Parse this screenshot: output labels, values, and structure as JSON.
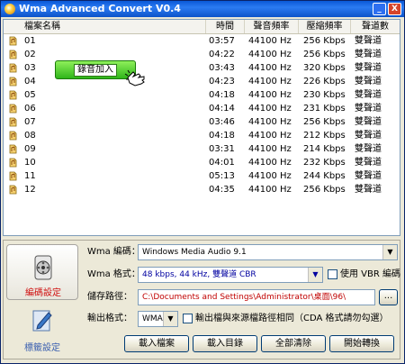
{
  "window": {
    "title": "Wma Advanced Convert V0.4",
    "min": "_",
    "close": "X"
  },
  "list": {
    "headers": {
      "name": "檔案名稱",
      "time": "時間",
      "samplerate": "聲音頻率",
      "bitrate": "壓縮頻率",
      "channels": "聲道數"
    },
    "rows": [
      {
        "name": "01",
        "time": "03:57",
        "samplerate": "44100 Hz",
        "bitrate": "256 Kbps",
        "channels": "雙聲道"
      },
      {
        "name": "02",
        "time": "04:22",
        "samplerate": "44100 Hz",
        "bitrate": "256 Kbps",
        "channels": "雙聲道"
      },
      {
        "name": "03",
        "time": "03:43",
        "samplerate": "44100 Hz",
        "bitrate": "320 Kbps",
        "channels": "雙聲道"
      },
      {
        "name": "04",
        "time": "04:23",
        "samplerate": "44100 Hz",
        "bitrate": "226 Kbps",
        "channels": "雙聲道"
      },
      {
        "name": "05",
        "time": "04:18",
        "samplerate": "44100 Hz",
        "bitrate": "230 Kbps",
        "channels": "雙聲道"
      },
      {
        "name": "06",
        "time": "04:14",
        "samplerate": "44100 Hz",
        "bitrate": "231 Kbps",
        "channels": "雙聲道"
      },
      {
        "name": "07",
        "time": "03:46",
        "samplerate": "44100 Hz",
        "bitrate": "256 Kbps",
        "channels": "雙聲道"
      },
      {
        "name": "08",
        "time": "04:18",
        "samplerate": "44100 Hz",
        "bitrate": "212 Kbps",
        "channels": "雙聲道"
      },
      {
        "name": "09",
        "time": "03:31",
        "samplerate": "44100 Hz",
        "bitrate": "214 Kbps",
        "channels": "雙聲道"
      },
      {
        "name": "10",
        "time": "04:01",
        "samplerate": "44100 Hz",
        "bitrate": "232 Kbps",
        "channels": "雙聲道"
      },
      {
        "name": "11",
        "time": "05:13",
        "samplerate": "44100 Hz",
        "bitrate": "244 Kbps",
        "channels": "雙聲道"
      },
      {
        "name": "12",
        "time": "04:35",
        "samplerate": "44100 Hz",
        "bitrate": "256 Kbps",
        "channels": "雙聲道"
      }
    ]
  },
  "drag_tooltip": "錄音加入",
  "sidebar": {
    "encode": "編碼設定",
    "tag": "標籤設定"
  },
  "form": {
    "codec_label": "Wma 編碼：",
    "codec_value": "Windows Media Audio 9.1",
    "format_label": "Wma 格式：",
    "format_value": "48 kbps, 44 kHz, 雙聲道 CBR",
    "vbr_label": "使用 VBR 編碼",
    "path_label": "儲存路徑：",
    "path_value": "C:\\Documents and Settings\\Administrator\\桌面\\96\\",
    "browse_label": "...",
    "outfmt_label": "輸出格式：",
    "outfmt_value": "WMA",
    "samepath_label": "輸出檔與來源檔路徑相同（CDA 格式請勿勾選）"
  },
  "buttons": {
    "add_file": "載入檔案",
    "add_dir": "載入目錄",
    "clear": "全部清除",
    "start": "開始轉換"
  },
  "colors": {
    "accent": "#0a58d6",
    "path_text": "#c00000",
    "format_text": "#0000a0"
  }
}
